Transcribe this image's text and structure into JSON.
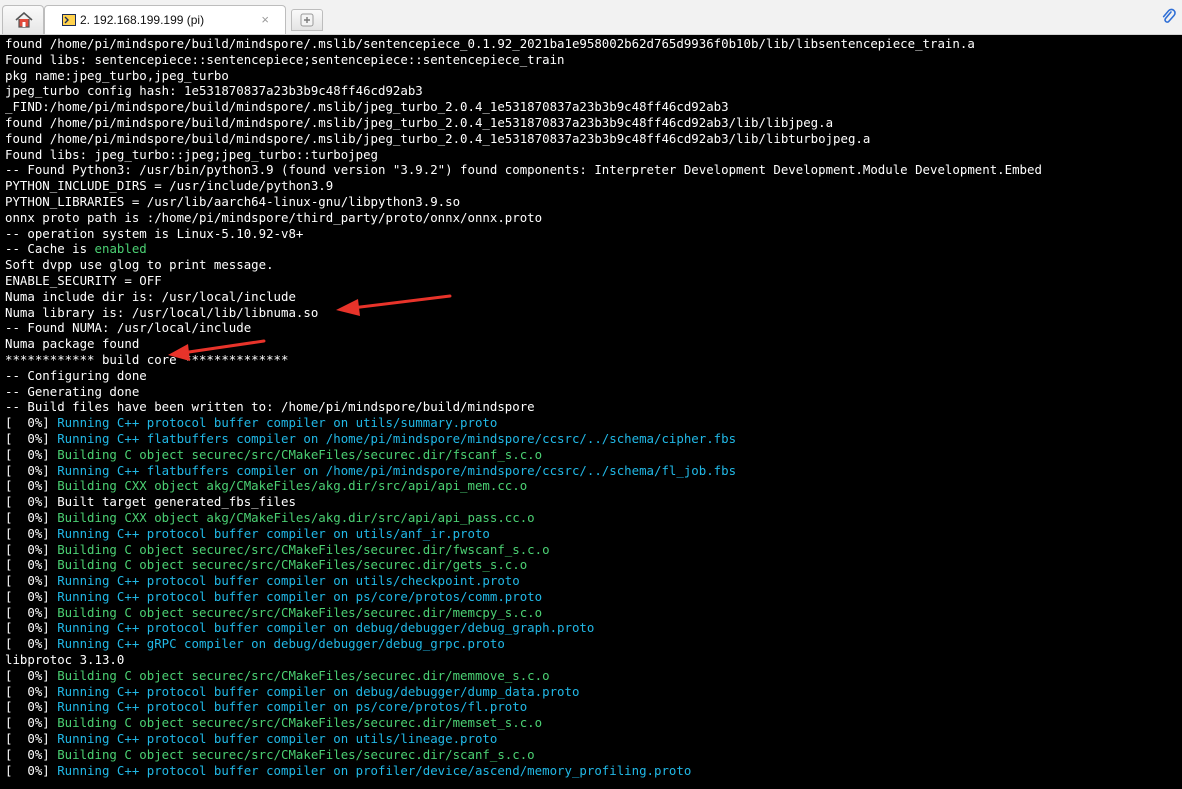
{
  "tabs": {
    "session_title": "2. 192.168.199.199 (pi)",
    "close_glyph": "×"
  },
  "terminal": {
    "lines": [
      {
        "t": "found /home/pi/mindspore/build/mindspore/.mslib/sentencepiece_0.1.92_2021ba1e958002b62d765d9936f0b10b/lib/libsentencepiece_train.a"
      },
      {
        "t": "Found libs: sentencepiece::sentencepiece;sentencepiece::sentencepiece_train"
      },
      {
        "t": "pkg name:jpeg_turbo,jpeg_turbo"
      },
      {
        "t": "jpeg_turbo config hash: 1e531870837a23b3b9c48ff46cd92ab3"
      },
      {
        "t": "_FIND:/home/pi/mindspore/build/mindspore/.mslib/jpeg_turbo_2.0.4_1e531870837a23b3b9c48ff46cd92ab3"
      },
      {
        "t": "found /home/pi/mindspore/build/mindspore/.mslib/jpeg_turbo_2.0.4_1e531870837a23b3b9c48ff46cd92ab3/lib/libjpeg.a"
      },
      {
        "t": "found /home/pi/mindspore/build/mindspore/.mslib/jpeg_turbo_2.0.4_1e531870837a23b3b9c48ff46cd92ab3/lib/libturbojpeg.a"
      },
      {
        "t": "Found libs: jpeg_turbo::jpeg;jpeg_turbo::turbojpeg"
      },
      {
        "t": "-- Found Python3: /usr/bin/python3.9 (found version \"3.9.2\") found components: Interpreter Development Development.Module Development.Embed"
      },
      {
        "t": "PYTHON_INCLUDE_DIRS = /usr/include/python3.9"
      },
      {
        "t": "PYTHON_LIBRARIES = /usr/lib/aarch64-linux-gnu/libpython3.9.so"
      },
      {
        "t": "onnx proto path is :/home/pi/mindspore/third_party/proto/onnx/onnx.proto"
      },
      {
        "t": "-- operation system is Linux-5.10.92-v8+"
      },
      {
        "t": "-- Cache is ",
        "hl": "enabled"
      },
      {
        "t": "Soft dvpp use glog to print message."
      },
      {
        "t": "ENABLE_SECURITY = OFF"
      },
      {
        "t": "Numa include dir is: /usr/local/include"
      },
      {
        "t": "Numa library is: /usr/local/lib/libnuma.so"
      },
      {
        "t": "-- Found NUMA: /usr/local/include"
      },
      {
        "t": "Numa package found"
      },
      {
        "t": "************ build core **************"
      },
      {
        "t": "-- Configuring done"
      },
      {
        "t": "-- Generating done"
      },
      {
        "t": "-- Build files have been written to: /home/pi/mindspore/build/mindspore"
      },
      {
        "p": "[  0%] ",
        "t": "Running C++ protocol buffer compiler on utils/summary.proto",
        "c": "c"
      },
      {
        "p": "[  0%] ",
        "t": "Running C++ flatbuffers compiler on /home/pi/mindspore/mindspore/ccsrc/../schema/cipher.fbs",
        "c": "c"
      },
      {
        "p": "[  0%] ",
        "t": "Building C object securec/src/CMakeFiles/securec.dir/fscanf_s.c.o",
        "c": "g"
      },
      {
        "p": "[  0%] ",
        "t": "Running C++ flatbuffers compiler on /home/pi/mindspore/mindspore/ccsrc/../schema/fl_job.fbs",
        "c": "c"
      },
      {
        "p": "[  0%] ",
        "t": "Building CXX object akg/CMakeFiles/akg.dir/src/api/api_mem.cc.o",
        "c": "g"
      },
      {
        "p": "[  0%] ",
        "t": "Built target generated_fbs_files",
        "c": "w"
      },
      {
        "p": "[  0%] ",
        "t": "Building CXX object akg/CMakeFiles/akg.dir/src/api/api_pass.cc.o",
        "c": "g"
      },
      {
        "p": "[  0%] ",
        "t": "Running C++ protocol buffer compiler on utils/anf_ir.proto",
        "c": "c"
      },
      {
        "p": "[  0%] ",
        "t": "Building C object securec/src/CMakeFiles/securec.dir/fwscanf_s.c.o",
        "c": "g"
      },
      {
        "p": "[  0%] ",
        "t": "Building C object securec/src/CMakeFiles/securec.dir/gets_s.c.o",
        "c": "g"
      },
      {
        "p": "[  0%] ",
        "t": "Running C++ protocol buffer compiler on utils/checkpoint.proto",
        "c": "c"
      },
      {
        "p": "[  0%] ",
        "t": "Running C++ protocol buffer compiler on ps/core/protos/comm.proto",
        "c": "c"
      },
      {
        "p": "[  0%] ",
        "t": "Building C object securec/src/CMakeFiles/securec.dir/memcpy_s.c.o",
        "c": "g"
      },
      {
        "p": "[  0%] ",
        "t": "Running C++ protocol buffer compiler on debug/debugger/debug_graph.proto",
        "c": "c"
      },
      {
        "p": "[  0%] ",
        "t": "Running C++ gRPC compiler on debug/debugger/debug_grpc.proto",
        "c": "c"
      },
      {
        "t": "libprotoc 3.13.0"
      },
      {
        "p": "[  0%] ",
        "t": "Building C object securec/src/CMakeFiles/securec.dir/memmove_s.c.o",
        "c": "g"
      },
      {
        "p": "[  0%] ",
        "t": "Running C++ protocol buffer compiler on debug/debugger/dump_data.proto",
        "c": "c"
      },
      {
        "p": "[  0%] ",
        "t": "Running C++ protocol buffer compiler on ps/core/protos/fl.proto",
        "c": "c"
      },
      {
        "p": "[  0%] ",
        "t": "Building C object securec/src/CMakeFiles/securec.dir/memset_s.c.o",
        "c": "g"
      },
      {
        "p": "[  0%] ",
        "t": "Running C++ protocol buffer compiler on utils/lineage.proto",
        "c": "c"
      },
      {
        "p": "[  0%] ",
        "t": "Building C object securec/src/CMakeFiles/securec.dir/scanf_s.c.o",
        "c": "g"
      },
      {
        "p": "[  0%] ",
        "t": "Running C++ protocol buffer compiler on profiler/device/ascend/memory_profiling.proto",
        "c": "c"
      }
    ]
  },
  "icons": {
    "home": "home-icon",
    "terminal": "terminal-icon",
    "new_tab": "new-tab-icon",
    "attach": "paperclip-icon",
    "annotation": "red-arrow-icon"
  },
  "colors": {
    "background": "#000000",
    "text": "#ffffff",
    "green_output": "#4bd073",
    "cyan_output": "#21b8e6",
    "annotation_arrow": "#e8332a"
  }
}
